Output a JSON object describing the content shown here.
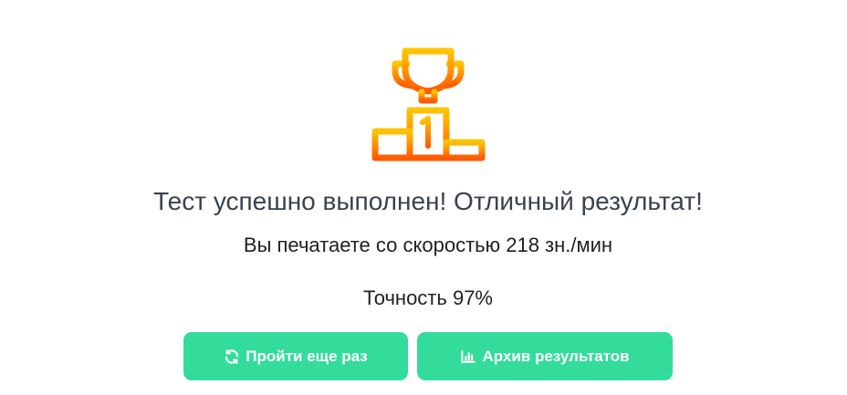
{
  "result": {
    "icon": "trophy-podium-icon",
    "headline": "Тест успешно выполнен! Отличный результат!",
    "speed_text": "Вы печатаете со скоростью 218 зн./мин",
    "accuracy_text": "Точность 97%"
  },
  "actions": {
    "retry_label": "Пройти еще раз",
    "retry_icon": "refresh-icon",
    "archive_label": "Архив результатов",
    "archive_icon": "bar-chart-icon"
  },
  "colors": {
    "button_bg": "#33dc9b",
    "trophy_gradient_top": "#ffc400",
    "trophy_gradient_bottom": "#ff5a00",
    "headline_text": "#39424e"
  }
}
